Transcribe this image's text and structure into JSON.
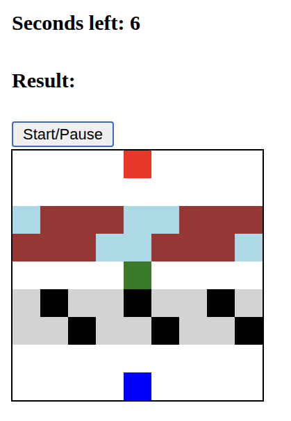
{
  "timer": {
    "text": "Seconds left: 6"
  },
  "result": {
    "text": "Result:"
  },
  "button": {
    "label": "Start/Pause"
  },
  "board": {
    "rows": [
      {
        "cells": [
          {
            "color": "#ffffff"
          },
          {
            "color": "#ffffff"
          },
          {
            "color": "#ffffff"
          },
          {
            "color": "#ffffff"
          },
          {
            "color": "#e8372a"
          },
          {
            "color": "#ffffff"
          },
          {
            "color": "#ffffff"
          },
          {
            "color": "#ffffff"
          },
          {
            "color": "#ffffff"
          }
        ]
      },
      {
        "cells": [
          {
            "color": "#ffffff"
          },
          {
            "color": "#ffffff"
          },
          {
            "color": "#ffffff"
          },
          {
            "color": "#ffffff"
          },
          {
            "color": "#ffffff"
          },
          {
            "color": "#ffffff"
          },
          {
            "color": "#ffffff"
          },
          {
            "color": "#ffffff"
          },
          {
            "color": "#ffffff"
          }
        ]
      },
      {
        "cells": [
          {
            "color": "#add8e6"
          },
          {
            "color": "#973735"
          },
          {
            "color": "#973735"
          },
          {
            "color": "#973735"
          },
          {
            "color": "#add8e6"
          },
          {
            "color": "#add8e6"
          },
          {
            "color": "#973735"
          },
          {
            "color": "#973735"
          },
          {
            "color": "#973735"
          }
        ]
      },
      {
        "cells": [
          {
            "color": "#973735"
          },
          {
            "color": "#973735"
          },
          {
            "color": "#973735"
          },
          {
            "color": "#add8e6"
          },
          {
            "color": "#add8e6"
          },
          {
            "color": "#973735"
          },
          {
            "color": "#973735"
          },
          {
            "color": "#973735"
          },
          {
            "color": "#add8e6"
          }
        ]
      },
      {
        "cells": [
          {
            "color": "#ffffff"
          },
          {
            "color": "#ffffff"
          },
          {
            "color": "#ffffff"
          },
          {
            "color": "#ffffff"
          },
          {
            "color": "#3a7a28"
          },
          {
            "color": "#ffffff"
          },
          {
            "color": "#ffffff"
          },
          {
            "color": "#ffffff"
          },
          {
            "color": "#ffffff"
          }
        ]
      },
      {
        "cells": [
          {
            "color": "#d3d3d3"
          },
          {
            "color": "#000000"
          },
          {
            "color": "#d3d3d3"
          },
          {
            "color": "#d3d3d3"
          },
          {
            "color": "#000000"
          },
          {
            "color": "#d3d3d3"
          },
          {
            "color": "#d3d3d3"
          },
          {
            "color": "#000000"
          },
          {
            "color": "#d3d3d3"
          }
        ]
      },
      {
        "cells": [
          {
            "color": "#d3d3d3"
          },
          {
            "color": "#d3d3d3"
          },
          {
            "color": "#000000"
          },
          {
            "color": "#d3d3d3"
          },
          {
            "color": "#d3d3d3"
          },
          {
            "color": "#000000"
          },
          {
            "color": "#d3d3d3"
          },
          {
            "color": "#d3d3d3"
          },
          {
            "color": "#000000"
          }
        ]
      },
      {
        "cells": [
          {
            "color": "#ffffff"
          },
          {
            "color": "#ffffff"
          },
          {
            "color": "#ffffff"
          },
          {
            "color": "#ffffff"
          },
          {
            "color": "#ffffff"
          },
          {
            "color": "#ffffff"
          },
          {
            "color": "#ffffff"
          },
          {
            "color": "#ffffff"
          },
          {
            "color": "#ffffff"
          }
        ]
      },
      {
        "cells": [
          {
            "color": "#ffffff"
          },
          {
            "color": "#ffffff"
          },
          {
            "color": "#ffffff"
          },
          {
            "color": "#ffffff"
          },
          {
            "color": "#0000ff"
          },
          {
            "color": "#ffffff"
          },
          {
            "color": "#ffffff"
          },
          {
            "color": "#ffffff"
          },
          {
            "color": "#ffffff"
          }
        ]
      }
    ]
  }
}
